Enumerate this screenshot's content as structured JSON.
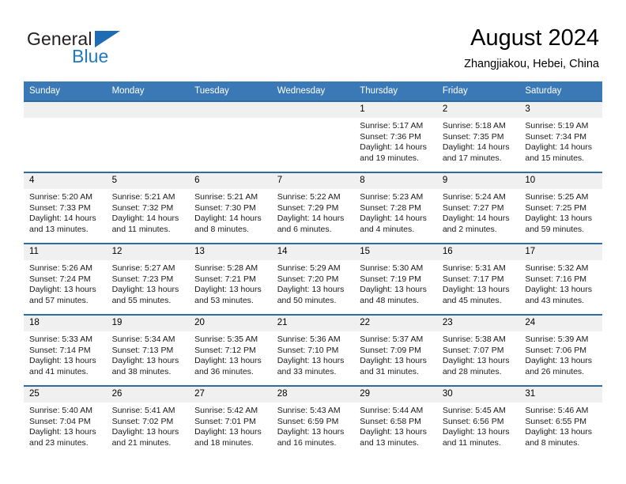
{
  "brand": {
    "name_top": "General",
    "name_bottom": "Blue",
    "triangle_color": "#1f6cb4",
    "text_color": "#231f20",
    "blue_color": "#2379c0"
  },
  "header": {
    "title": "August 2024",
    "subtitle": "Zhangjiakou, Hebei, China"
  },
  "theme": {
    "header_row_bg": "#3b79b6",
    "row_divider": "#2e6da4",
    "daynum_bg": "#f0f0f0"
  },
  "weekday_headers": [
    "Sunday",
    "Monday",
    "Tuesday",
    "Wednesday",
    "Thursday",
    "Friday",
    "Saturday"
  ],
  "weeks": [
    [
      {
        "day": "",
        "sunrise": "",
        "sunset": "",
        "daylight_line1": "",
        "daylight_line2": ""
      },
      {
        "day": "",
        "sunrise": "",
        "sunset": "",
        "daylight_line1": "",
        "daylight_line2": ""
      },
      {
        "day": "",
        "sunrise": "",
        "sunset": "",
        "daylight_line1": "",
        "daylight_line2": ""
      },
      {
        "day": "",
        "sunrise": "",
        "sunset": "",
        "daylight_line1": "",
        "daylight_line2": ""
      },
      {
        "day": "1",
        "sunrise": "Sunrise: 5:17 AM",
        "sunset": "Sunset: 7:36 PM",
        "daylight_line1": "Daylight: 14 hours",
        "daylight_line2": "and 19 minutes."
      },
      {
        "day": "2",
        "sunrise": "Sunrise: 5:18 AM",
        "sunset": "Sunset: 7:35 PM",
        "daylight_line1": "Daylight: 14 hours",
        "daylight_line2": "and 17 minutes."
      },
      {
        "day": "3",
        "sunrise": "Sunrise: 5:19 AM",
        "sunset": "Sunset: 7:34 PM",
        "daylight_line1": "Daylight: 14 hours",
        "daylight_line2": "and 15 minutes."
      }
    ],
    [
      {
        "day": "4",
        "sunrise": "Sunrise: 5:20 AM",
        "sunset": "Sunset: 7:33 PM",
        "daylight_line1": "Daylight: 14 hours",
        "daylight_line2": "and 13 minutes."
      },
      {
        "day": "5",
        "sunrise": "Sunrise: 5:21 AM",
        "sunset": "Sunset: 7:32 PM",
        "daylight_line1": "Daylight: 14 hours",
        "daylight_line2": "and 11 minutes."
      },
      {
        "day": "6",
        "sunrise": "Sunrise: 5:21 AM",
        "sunset": "Sunset: 7:30 PM",
        "daylight_line1": "Daylight: 14 hours",
        "daylight_line2": "and 8 minutes."
      },
      {
        "day": "7",
        "sunrise": "Sunrise: 5:22 AM",
        "sunset": "Sunset: 7:29 PM",
        "daylight_line1": "Daylight: 14 hours",
        "daylight_line2": "and 6 minutes."
      },
      {
        "day": "8",
        "sunrise": "Sunrise: 5:23 AM",
        "sunset": "Sunset: 7:28 PM",
        "daylight_line1": "Daylight: 14 hours",
        "daylight_line2": "and 4 minutes."
      },
      {
        "day": "9",
        "sunrise": "Sunrise: 5:24 AM",
        "sunset": "Sunset: 7:27 PM",
        "daylight_line1": "Daylight: 14 hours",
        "daylight_line2": "and 2 minutes."
      },
      {
        "day": "10",
        "sunrise": "Sunrise: 5:25 AM",
        "sunset": "Sunset: 7:25 PM",
        "daylight_line1": "Daylight: 13 hours",
        "daylight_line2": "and 59 minutes."
      }
    ],
    [
      {
        "day": "11",
        "sunrise": "Sunrise: 5:26 AM",
        "sunset": "Sunset: 7:24 PM",
        "daylight_line1": "Daylight: 13 hours",
        "daylight_line2": "and 57 minutes."
      },
      {
        "day": "12",
        "sunrise": "Sunrise: 5:27 AM",
        "sunset": "Sunset: 7:23 PM",
        "daylight_line1": "Daylight: 13 hours",
        "daylight_line2": "and 55 minutes."
      },
      {
        "day": "13",
        "sunrise": "Sunrise: 5:28 AM",
        "sunset": "Sunset: 7:21 PM",
        "daylight_line1": "Daylight: 13 hours",
        "daylight_line2": "and 53 minutes."
      },
      {
        "day": "14",
        "sunrise": "Sunrise: 5:29 AM",
        "sunset": "Sunset: 7:20 PM",
        "daylight_line1": "Daylight: 13 hours",
        "daylight_line2": "and 50 minutes."
      },
      {
        "day": "15",
        "sunrise": "Sunrise: 5:30 AM",
        "sunset": "Sunset: 7:19 PM",
        "daylight_line1": "Daylight: 13 hours",
        "daylight_line2": "and 48 minutes."
      },
      {
        "day": "16",
        "sunrise": "Sunrise: 5:31 AM",
        "sunset": "Sunset: 7:17 PM",
        "daylight_line1": "Daylight: 13 hours",
        "daylight_line2": "and 45 minutes."
      },
      {
        "day": "17",
        "sunrise": "Sunrise: 5:32 AM",
        "sunset": "Sunset: 7:16 PM",
        "daylight_line1": "Daylight: 13 hours",
        "daylight_line2": "and 43 minutes."
      }
    ],
    [
      {
        "day": "18",
        "sunrise": "Sunrise: 5:33 AM",
        "sunset": "Sunset: 7:14 PM",
        "daylight_line1": "Daylight: 13 hours",
        "daylight_line2": "and 41 minutes."
      },
      {
        "day": "19",
        "sunrise": "Sunrise: 5:34 AM",
        "sunset": "Sunset: 7:13 PM",
        "daylight_line1": "Daylight: 13 hours",
        "daylight_line2": "and 38 minutes."
      },
      {
        "day": "20",
        "sunrise": "Sunrise: 5:35 AM",
        "sunset": "Sunset: 7:12 PM",
        "daylight_line1": "Daylight: 13 hours",
        "daylight_line2": "and 36 minutes."
      },
      {
        "day": "21",
        "sunrise": "Sunrise: 5:36 AM",
        "sunset": "Sunset: 7:10 PM",
        "daylight_line1": "Daylight: 13 hours",
        "daylight_line2": "and 33 minutes."
      },
      {
        "day": "22",
        "sunrise": "Sunrise: 5:37 AM",
        "sunset": "Sunset: 7:09 PM",
        "daylight_line1": "Daylight: 13 hours",
        "daylight_line2": "and 31 minutes."
      },
      {
        "day": "23",
        "sunrise": "Sunrise: 5:38 AM",
        "sunset": "Sunset: 7:07 PM",
        "daylight_line1": "Daylight: 13 hours",
        "daylight_line2": "and 28 minutes."
      },
      {
        "day": "24",
        "sunrise": "Sunrise: 5:39 AM",
        "sunset": "Sunset: 7:06 PM",
        "daylight_line1": "Daylight: 13 hours",
        "daylight_line2": "and 26 minutes."
      }
    ],
    [
      {
        "day": "25",
        "sunrise": "Sunrise: 5:40 AM",
        "sunset": "Sunset: 7:04 PM",
        "daylight_line1": "Daylight: 13 hours",
        "daylight_line2": "and 23 minutes."
      },
      {
        "day": "26",
        "sunrise": "Sunrise: 5:41 AM",
        "sunset": "Sunset: 7:02 PM",
        "daylight_line1": "Daylight: 13 hours",
        "daylight_line2": "and 21 minutes."
      },
      {
        "day": "27",
        "sunrise": "Sunrise: 5:42 AM",
        "sunset": "Sunset: 7:01 PM",
        "daylight_line1": "Daylight: 13 hours",
        "daylight_line2": "and 18 minutes."
      },
      {
        "day": "28",
        "sunrise": "Sunrise: 5:43 AM",
        "sunset": "Sunset: 6:59 PM",
        "daylight_line1": "Daylight: 13 hours",
        "daylight_line2": "and 16 minutes."
      },
      {
        "day": "29",
        "sunrise": "Sunrise: 5:44 AM",
        "sunset": "Sunset: 6:58 PM",
        "daylight_line1": "Daylight: 13 hours",
        "daylight_line2": "and 13 minutes."
      },
      {
        "day": "30",
        "sunrise": "Sunrise: 5:45 AM",
        "sunset": "Sunset: 6:56 PM",
        "daylight_line1": "Daylight: 13 hours",
        "daylight_line2": "and 11 minutes."
      },
      {
        "day": "31",
        "sunrise": "Sunrise: 5:46 AM",
        "sunset": "Sunset: 6:55 PM",
        "daylight_line1": "Daylight: 13 hours",
        "daylight_line2": "and 8 minutes."
      }
    ]
  ]
}
